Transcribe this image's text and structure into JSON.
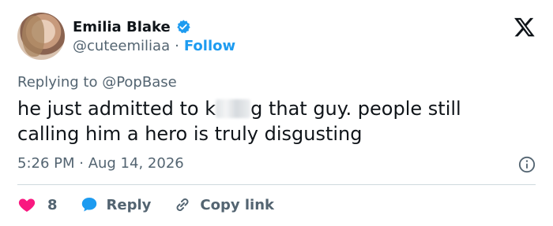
{
  "author": {
    "name": "Emilia Blake",
    "handle": "@cuteemiliaa",
    "separator": "·",
    "follow_label": "Follow"
  },
  "reply_context": {
    "prefix": "Replying to ",
    "mention": "@PopBase"
  },
  "tweet": {
    "text_before": "he just admitted to k",
    "text_after": "g that guy. people still calling him a hero is truly disgusting",
    "timestamp": "5:26 PM · Aug 14, 2026"
  },
  "actions": {
    "like_count": "8",
    "reply_label": "Reply",
    "copy_link_label": "Copy link"
  },
  "colors": {
    "accent": "#1d9bf0",
    "like": "#f91880",
    "secondary_text": "#536471",
    "primary_text": "#0f1419"
  },
  "icons": {
    "verified": "verified-badge-icon",
    "platform": "x-logo-icon",
    "info": "info-icon",
    "like": "heart-icon",
    "reply": "speech-bubble-icon",
    "copy_link": "link-icon"
  }
}
